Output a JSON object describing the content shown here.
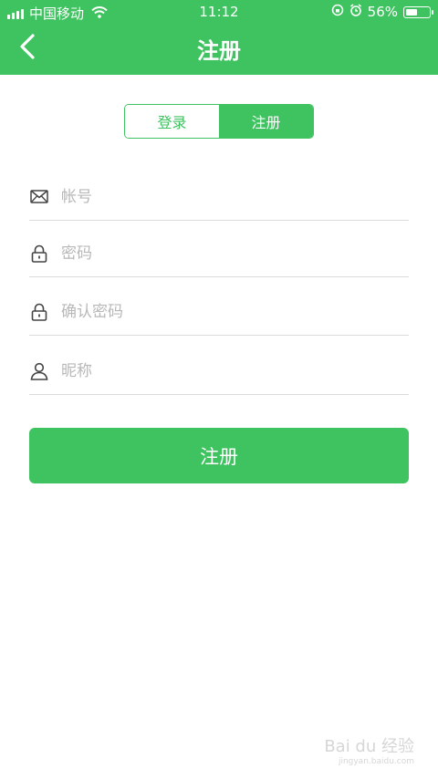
{
  "status_bar": {
    "carrier": "中国移动",
    "time": "11:12",
    "battery_percent": "56%",
    "battery_level": 0.56
  },
  "header": {
    "title": "注册",
    "back_icon": "chevron-left-icon"
  },
  "segmented": {
    "login_label": "登录",
    "register_label": "注册",
    "selected": "register"
  },
  "form": {
    "account": {
      "placeholder": "帐号",
      "value": "",
      "icon": "mail-icon"
    },
    "password": {
      "placeholder": "密码",
      "value": "",
      "icon": "lock-icon"
    },
    "confirm_password": {
      "placeholder": "确认密码",
      "value": "",
      "icon": "lock-icon"
    },
    "nickname": {
      "placeholder": "昵称",
      "value": "",
      "icon": "user-icon"
    }
  },
  "submit_label": "注册",
  "colors": {
    "accent": "#3fc260",
    "divider": "#dcdcdc",
    "placeholder": "#b8b8b8"
  },
  "watermark": {
    "brand": "Bai du 经验",
    "url": "jingyan.baidu.com"
  }
}
